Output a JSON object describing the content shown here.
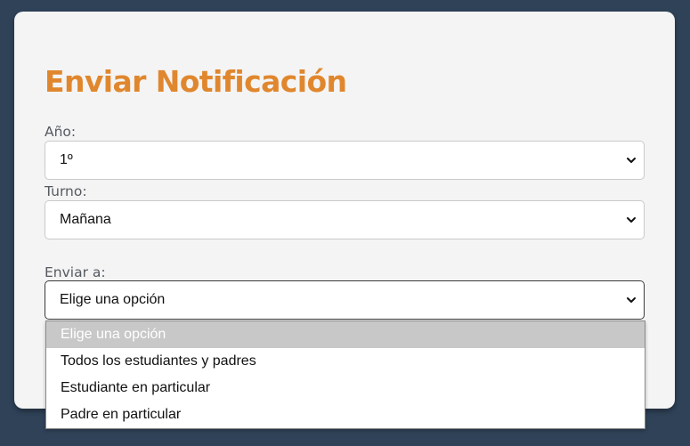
{
  "form": {
    "title": "Enviar Notificación",
    "year": {
      "label": "Año:",
      "value": "1º"
    },
    "shift": {
      "label": "Turno:",
      "value": "Mañana"
    },
    "send_to": {
      "label": "Enviar a:",
      "value": "Elige una opción",
      "options": [
        "Elige una opción",
        "Todos los estudiantes y padres",
        "Estudiante en particular",
        "Padre en particular"
      ]
    }
  },
  "colors": {
    "background": "#2f4258",
    "card": "#f4f4f4",
    "title": "#e0872e",
    "highlighted_option": "#c8c8c8"
  },
  "icons": {
    "dropdown": "chevron-down-icon"
  }
}
